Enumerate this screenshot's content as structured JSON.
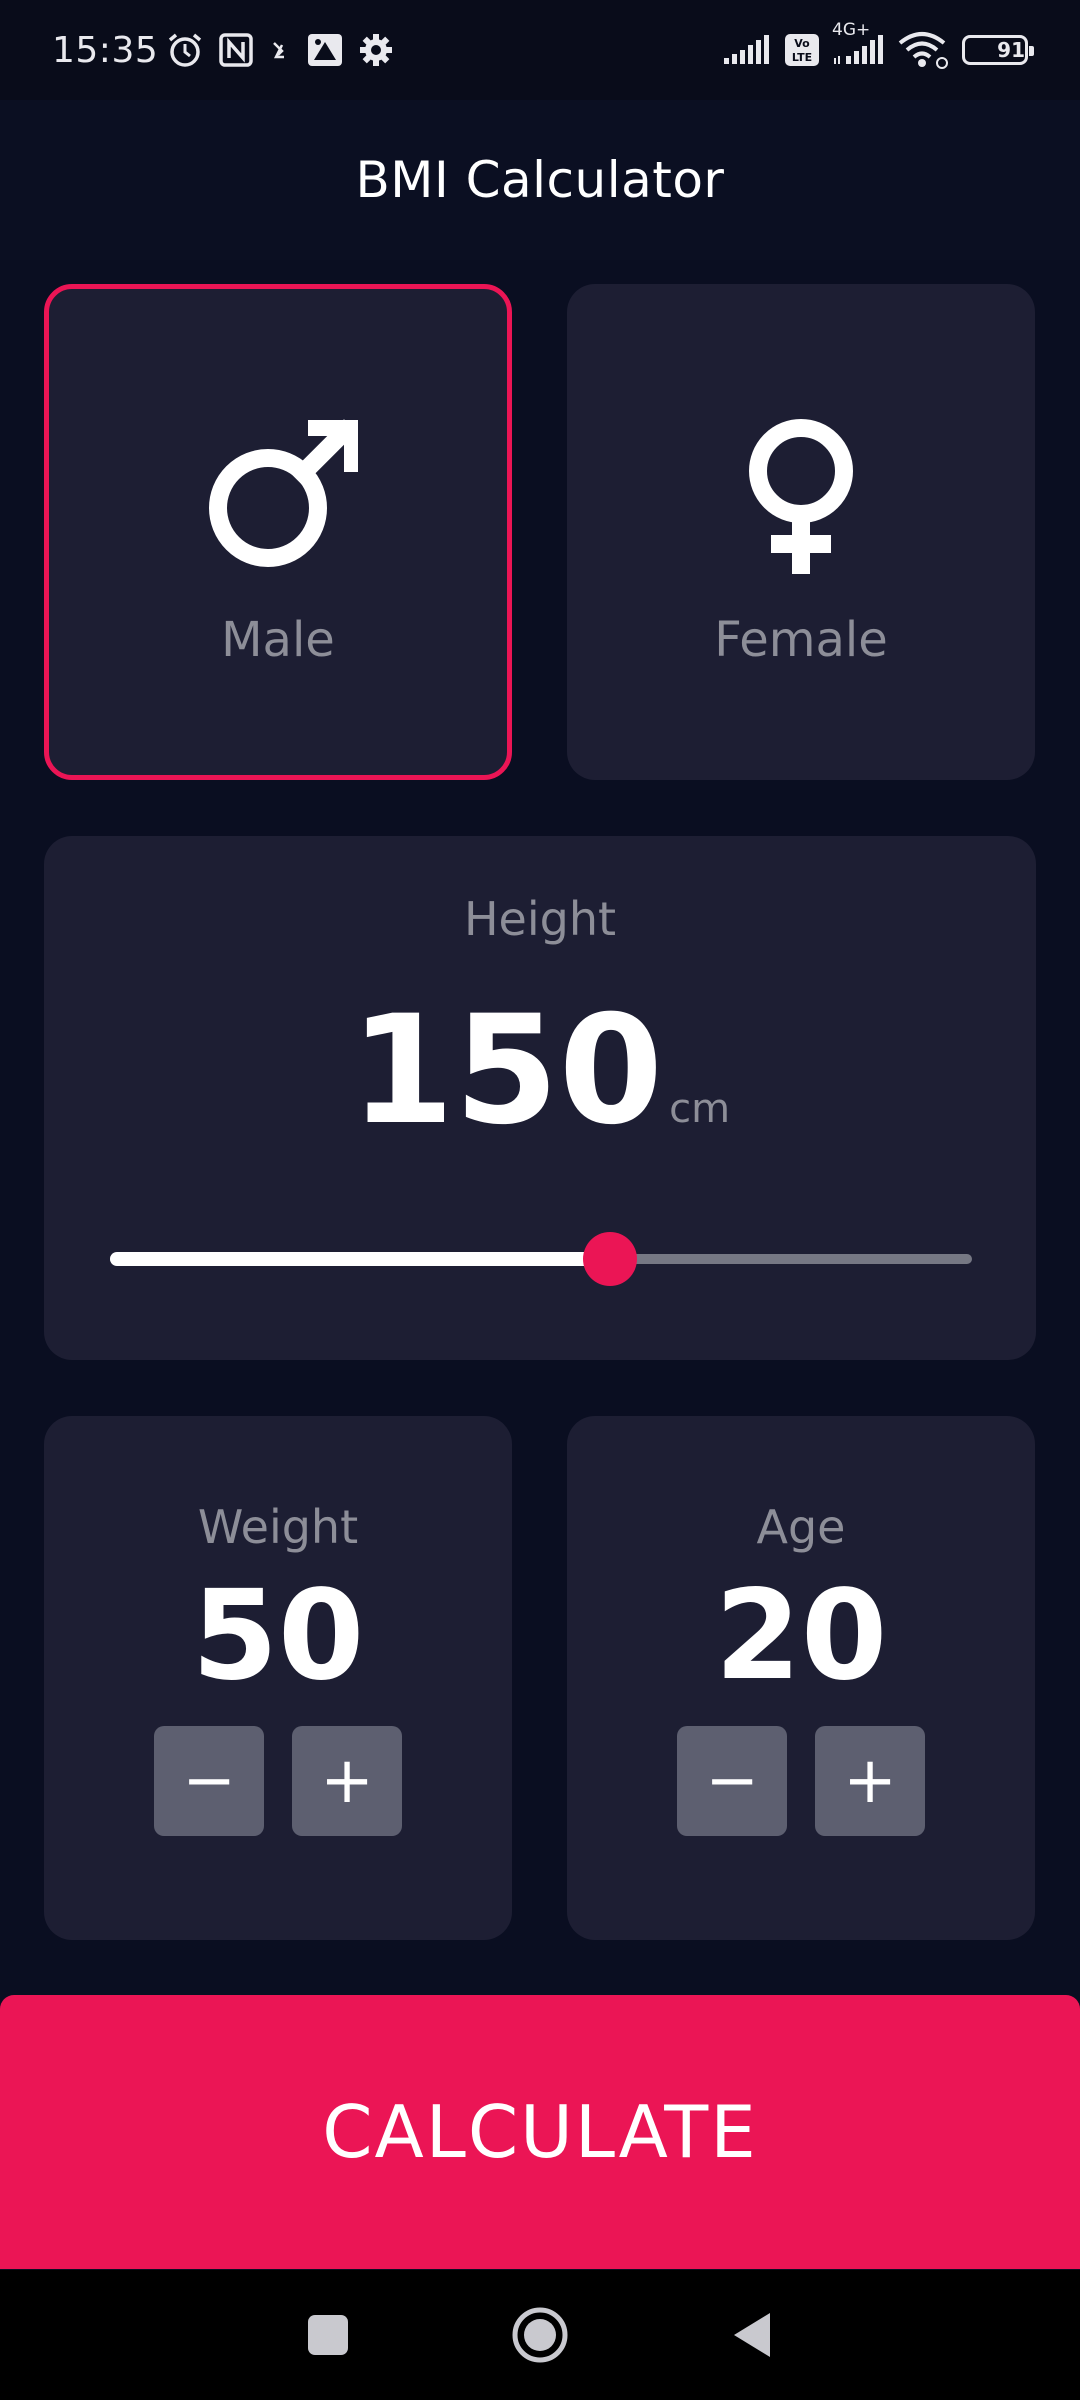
{
  "status_bar": {
    "time": "15:35",
    "network": "4G+",
    "volte": "Vo LTE",
    "battery": "91",
    "icons": [
      "alarm-icon",
      "nfc-icon",
      "sim-icon",
      "photo-icon",
      "settings-icon",
      "signal-icon",
      "volte-icon",
      "signal-icon",
      "wifi-icon",
      "battery-icon"
    ]
  },
  "app_bar": {
    "title": "BMI Calculator"
  },
  "gender": {
    "male": {
      "label": "Male",
      "icon": "male-icon",
      "selected": true
    },
    "female": {
      "label": "Female",
      "icon": "female-icon",
      "selected": false
    }
  },
  "height": {
    "label": "Height",
    "value": "150",
    "unit": "cm",
    "slider_fraction": 0.58
  },
  "weight": {
    "label": "Weight",
    "value": "50",
    "minus": "−",
    "plus": "+"
  },
  "age": {
    "label": "Age",
    "value": "20",
    "minus": "−",
    "plus": "+"
  },
  "calculate_button": {
    "label": "CALCULATE"
  },
  "colors": {
    "background": "#0a0e21",
    "card": "#1d1e33",
    "accent": "#eb1555",
    "muted_text": "#8d8e98",
    "button": "#5d5f70"
  },
  "nav_bar": {
    "icons": [
      "recent-apps-icon",
      "home-icon",
      "back-icon"
    ]
  }
}
